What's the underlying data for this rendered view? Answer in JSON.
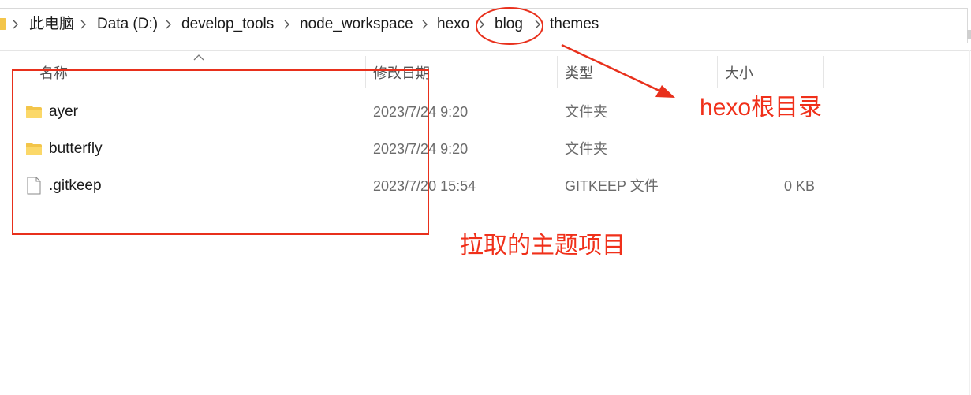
{
  "breadcrumb": {
    "items": [
      "此电脑",
      "Data (D:)",
      "develop_tools",
      "node_workspace",
      "hexo",
      "blog",
      "themes"
    ]
  },
  "columns": {
    "name": "名称",
    "date": "修改日期",
    "type": "类型",
    "size": "大小"
  },
  "files": [
    {
      "name": "ayer",
      "date": "2023/7/24 9:20",
      "type": "文件夹",
      "size": "",
      "icon": "folder-icon"
    },
    {
      "name": "butterfly",
      "date": "2023/7/24 9:20",
      "type": "文件夹",
      "size": "",
      "icon": "folder-icon"
    },
    {
      "name": ".gitkeep",
      "date": "2023/7/20 15:54",
      "type": "GITKEEP 文件",
      "size": "0 KB",
      "icon": "file-icon"
    }
  ],
  "annotations": {
    "root_label": "hexo根目录",
    "themes_label": "拉取的主题项目"
  },
  "colors": {
    "annotation": "#e8301c",
    "folder": "#f3c54a"
  }
}
